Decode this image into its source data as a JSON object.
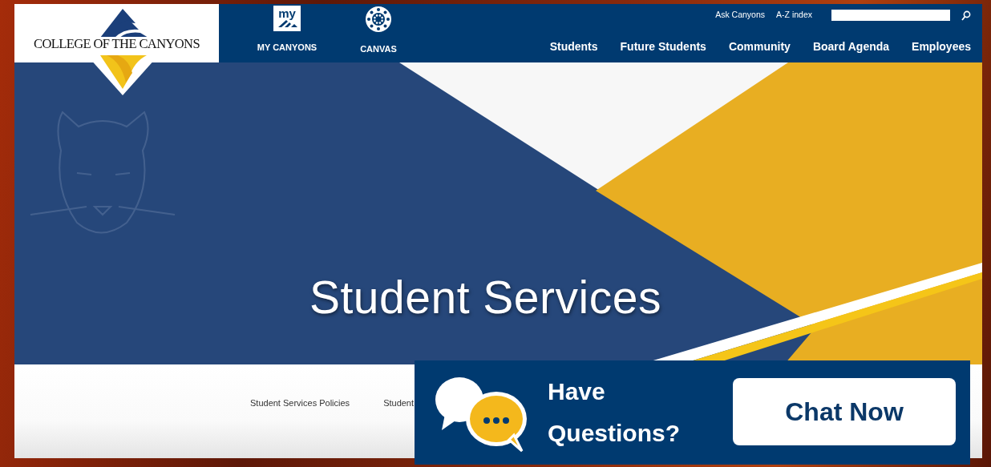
{
  "logo": {
    "text": "COLLEGE OF THE CANYONS"
  },
  "quick_links": [
    {
      "label": "MY CANYONS",
      "kind": "my",
      "icon_text": "my"
    },
    {
      "label": "CANVAS",
      "kind": "canvas"
    }
  ],
  "utility_links": [
    "Ask Canyons",
    "A-Z index"
  ],
  "main_nav": [
    "Students",
    "Future Students",
    "Community",
    "Board Agenda",
    "Employees"
  ],
  "hero": {
    "title": "Student Services"
  },
  "sub_nav": [
    "Student Services Policies",
    "Student"
  ],
  "chat": {
    "prompt_lines": [
      "Have",
      "Questions?"
    ],
    "button": "Chat Now"
  }
}
